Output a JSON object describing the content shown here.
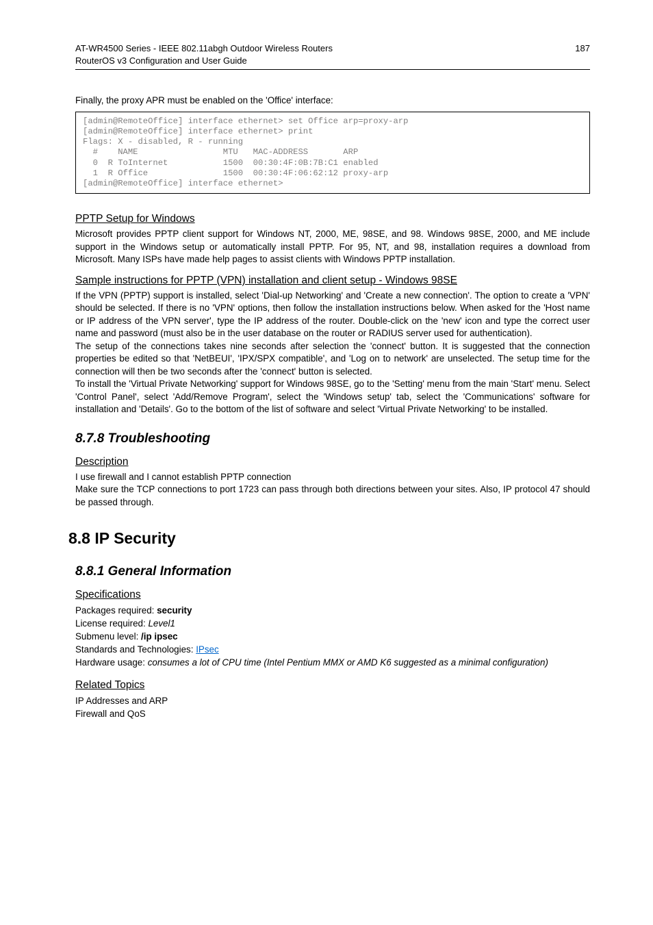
{
  "header": {
    "title_line1": "AT-WR4500 Series - IEEE 802.11abgh Outdoor Wireless Routers",
    "title_line2": "RouterOS v3 Configuration and User Guide",
    "page_number": "187"
  },
  "intro_line": "Finally, the proxy APR must be enabled on the 'Office' interface:",
  "codeblock": "[admin@RemoteOffice] interface ethernet> set Office arp=proxy-arp\n[admin@RemoteOffice] interface ethernet> print\nFlags: X - disabled, R - running\n  #    NAME                 MTU   MAC-ADDRESS       ARP\n  0  R ToInternet           1500  00:30:4F:0B:7B:C1 enabled\n  1  R Office               1500  00:30:4F:06:62:12 proxy-arp\n[admin@RemoteOffice] interface ethernet>",
  "pptp": {
    "heading": "PPTP Setup for Windows",
    "para": "Microsoft provides PPTP client support for Windows NT, 2000, ME, 98SE, and 98. Windows 98SE, 2000, and ME include support in the Windows setup or automatically install PPTP. For 95, NT, and 98, installation requires a download from Microsoft. Many ISPs have made help pages to assist clients with Windows PPTP installation."
  },
  "sample": {
    "heading": "Sample instructions for PPTP (VPN) installation and client setup - Windows 98SE",
    "para1": "If the VPN (PPTP) support is installed, select 'Dial-up Networking' and 'Create a new connection'. The option to create a 'VPN' should be selected. If there is no 'VPN' options, then follow the installation instructions below. When asked for the 'Host name or IP address of the VPN server', type the IP address of the router. Double-click on the 'new' icon and type the correct user name and password (must also be in the user database on the router or RADIUS server used for authentication).",
    "para2": "The setup of the connections takes nine seconds after selection the 'connect' button. It is suggested that the connection properties be edited so that 'NetBEUI', 'IPX/SPX compatible', and 'Log on to network' are unselected. The setup time for the connection will then be two seconds after the 'connect' button is selected.",
    "para3": "To install the 'Virtual Private Networking' support for Windows 98SE, go to the 'Setting' menu from the main 'Start' menu. Select 'Control Panel', select 'Add/Remove Program', select the 'Windows setup' tab, select the 'Communications' software for installation and 'Details'. Go to the bottom of the list of software and select 'Virtual Private Networking' to be installed."
  },
  "troubleshooting": {
    "heading": "8.7.8 Troubleshooting",
    "desc_heading": "Description",
    "line1": "I use firewall and I cannot establish PPTP connection",
    "line2": "Make sure the TCP connections to port 1723 can pass through both directions between your sites. Also, IP protocol 47 should be passed through."
  },
  "ipsec": {
    "heading": "8.8 IP Security",
    "gen_heading": "8.8.1 General Information",
    "spec_heading": "Specifications",
    "pkg_label": "Packages required: ",
    "pkg_value": "security",
    "lic_label": "License required: ",
    "lic_value": "Level1",
    "sub_label": "Submenu level: ",
    "sub_value": "/ip ipsec",
    "std_label": "Standards and Technologies: ",
    "std_link": "IPsec",
    "hw_label": "Hardware usage: ",
    "hw_value": "consumes a lot of CPU time (Intel Pentium MMX or AMD K6 suggested as a minimal configuration)",
    "related_heading": "Related Topics",
    "rel1": "IP Addresses and ARP",
    "rel2": "Firewall and QoS"
  }
}
